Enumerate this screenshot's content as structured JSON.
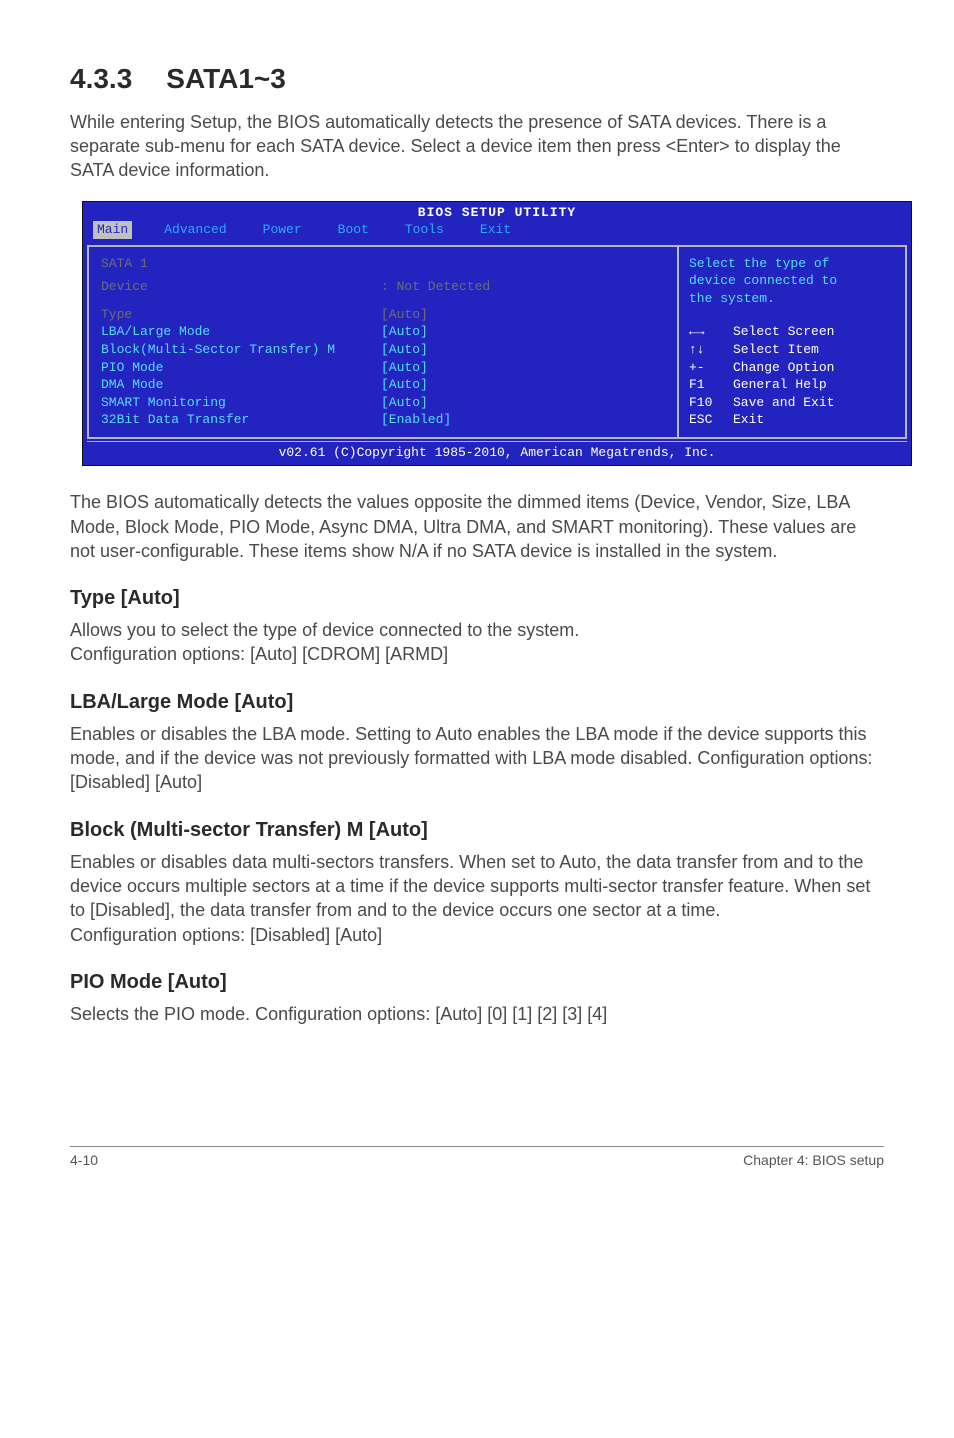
{
  "heading": {
    "number": "4.3.3",
    "title": "SATA1~3"
  },
  "intro": "While entering Setup, the BIOS automatically detects the presence of SATA devices. There is a separate sub-menu for each SATA device. Select a device item then press <Enter> to display the SATA device information.",
  "bios": {
    "utility_title": "BIOS SETUP UTILITY",
    "tabs": [
      "Main",
      "Advanced",
      "Power",
      "Boot",
      "Tools",
      "Exit"
    ],
    "active_tab": "Main",
    "left": {
      "header": "SATA 1",
      "device_label": "Device",
      "device_value": ": Not Detected",
      "rows": [
        {
          "label": "Type",
          "value": "[Auto]",
          "dim": true
        },
        {
          "label": "LBA/Large Mode",
          "value": "[Auto]"
        },
        {
          "label": "Block(Multi-Sector Transfer) M",
          "value": "[Auto]"
        },
        {
          "label": "PIO Mode",
          "value": "[Auto]"
        },
        {
          "label": "DMA Mode",
          "value": "[Auto]"
        },
        {
          "label": "SMART Monitoring",
          "value": "[Auto]"
        },
        {
          "label": "32Bit Data Transfer",
          "value": "[Enabled]"
        }
      ]
    },
    "right": {
      "help": "Select the type of\ndevice connected to\nthe system.",
      "keys": [
        {
          "k": "←→",
          "d": "Select Screen"
        },
        {
          "k": "↑↓",
          "d": "Select Item"
        },
        {
          "k": "+-",
          "d": "Change Option"
        },
        {
          "k": "F1",
          "d": "General Help"
        },
        {
          "k": "F10",
          "d": "Save and Exit"
        },
        {
          "k": "ESC",
          "d": "Exit"
        }
      ]
    },
    "copyright": "v02.61 (C)Copyright 1985-2010, American Megatrends, Inc."
  },
  "after_bios": "The BIOS automatically detects the values opposite the dimmed items (Device, Vendor, Size, LBA Mode, Block Mode, PIO Mode, Async DMA, Ultra DMA, and SMART monitoring). These values are not user-configurable. These items show N/A if no SATA device is installed in the system.",
  "sections": [
    {
      "title": "Type [Auto]",
      "body": "Allows you to select the type of device connected to the system.\nConfiguration options: [Auto] [CDROM] [ARMD]"
    },
    {
      "title": "LBA/Large Mode [Auto]",
      "body": "Enables or disables the LBA mode. Setting to Auto enables the LBA mode if the device supports this mode, and if the device was not previously formatted with LBA mode disabled. Configuration options: [Disabled] [Auto]"
    },
    {
      "title": "Block (Multi-sector Transfer) M [Auto]",
      "body": "Enables or disables data multi-sectors transfers. When set to Auto, the data transfer from and to the device occurs multiple sectors at a time if the device supports multi-sector transfer feature. When set to [Disabled], the data transfer from and to the device occurs one sector at a time.\nConfiguration options: [Disabled] [Auto]"
    },
    {
      "title": "PIO Mode [Auto]",
      "body": "Selects the PIO mode. Configuration options: [Auto] [0] [1] [2] [3] [4]"
    }
  ],
  "footer": {
    "left": "4-10",
    "right": "Chapter 4: BIOS setup"
  }
}
